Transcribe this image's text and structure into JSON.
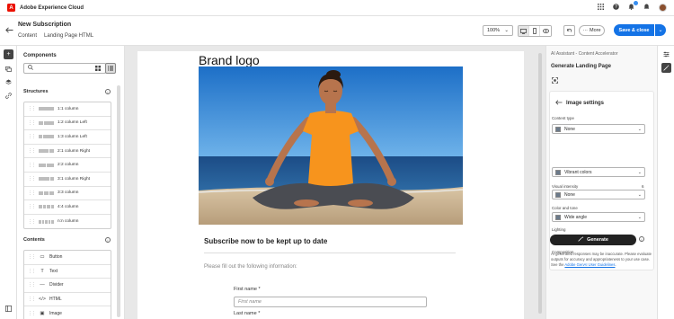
{
  "app": {
    "name": "Adobe Experience Cloud",
    "logo_letter": "A"
  },
  "header": {
    "title": "New Subscription",
    "breadcrumb": [
      "Content",
      "Landing Page HTML"
    ],
    "zoom": "100%",
    "more_label": "More",
    "save_label": "Save & close"
  },
  "left_panel": {
    "title": "Components",
    "structures_title": "Structures",
    "structures": [
      {
        "label": "1:1 column",
        "cols": [
          1
        ]
      },
      {
        "label": "1:2 column Left",
        "cols": [
          1,
          2
        ]
      },
      {
        "label": "1:3 column Left",
        "cols": [
          1,
          3
        ]
      },
      {
        "label": "2:1 column Right",
        "cols": [
          2,
          1
        ]
      },
      {
        "label": "2:2 column",
        "cols": [
          1,
          1
        ]
      },
      {
        "label": "3:1 column Right",
        "cols": [
          3,
          1
        ]
      },
      {
        "label": "3:3 column",
        "cols": [
          1,
          1,
          1
        ]
      },
      {
        "label": "4:4 column",
        "cols": [
          1,
          1,
          1,
          1
        ]
      },
      {
        "label": "n:n column",
        "cols": [
          1,
          1,
          1,
          1,
          1
        ]
      }
    ],
    "contents_title": "Contents",
    "contents": [
      {
        "label": "Button",
        "icon": "button-icon"
      },
      {
        "label": "Text",
        "icon": "text-icon"
      },
      {
        "label": "Divider",
        "icon": "divider-icon"
      },
      {
        "label": "HTML",
        "icon": "code-icon"
      },
      {
        "label": "Image",
        "icon": "image-icon"
      }
    ]
  },
  "canvas": {
    "brand": "Brand logo",
    "subscribe_heading": "Subscribe now to be kept up to date",
    "intro": "Please fill out the following information:",
    "fields": [
      {
        "label": "First name",
        "required_mark": "*",
        "placeholder": "First name"
      },
      {
        "label": "Last name",
        "required_mark": "*"
      }
    ]
  },
  "assistant": {
    "breadcrumb": "AI Assistant - Content Accelerator",
    "title": "Generate Landing Page",
    "settings_title": "Image settings",
    "content_type": {
      "label": "Content type",
      "value": "None"
    },
    "visual_intensity": {
      "label": "Visual intensity",
      "value": "6",
      "level": 0.5
    },
    "color_tone": {
      "label": "Color and tone",
      "value": "Vibrant colors"
    },
    "lighting": {
      "label": "Lighting",
      "value": "None"
    },
    "composition": {
      "label": "Composition",
      "value": "Wide angle"
    },
    "generate_label": "Generate",
    "disclaimer_text": "AI generated responses may be inaccurate. Please evaluate outputs for accuracy and appropriateness to your use case. See the",
    "disclaimer_link": "Adobe GenAI User Guidelines",
    "disclaimer_end": "."
  },
  "colors": {
    "accent": "#1473e6",
    "brand_red": "#eb1000",
    "shirt": "#f7941d",
    "sky": "#2c7fd0",
    "sea": "#1f4f86",
    "sand": "#c9b08e"
  }
}
